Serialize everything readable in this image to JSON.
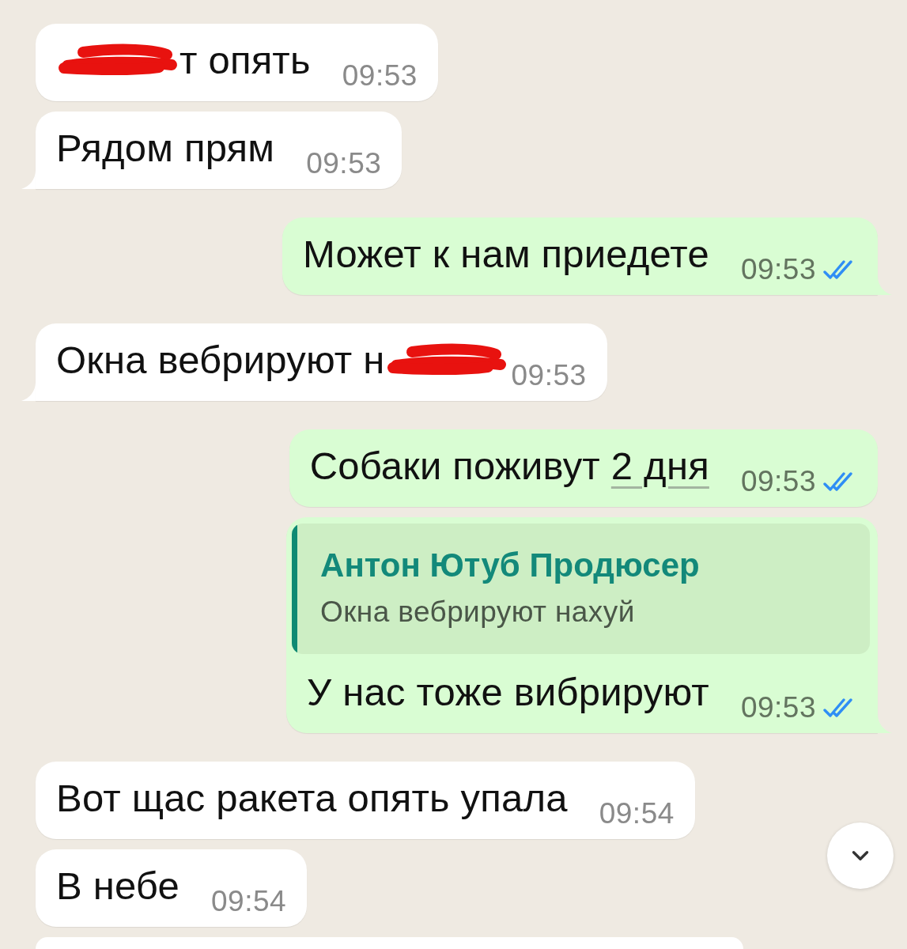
{
  "messages": [
    {
      "kind": "text",
      "outgoing": false,
      "redacted_start": true,
      "text": "т опять",
      "time": "09:53",
      "tail": false
    },
    {
      "kind": "text",
      "outgoing": false,
      "text": "Рядом прям",
      "time": "09:53",
      "tail": true
    },
    {
      "kind": "text",
      "outgoing": true,
      "text": "Может к нам приедете",
      "time": "09:53",
      "read": true,
      "tail": true
    },
    {
      "kind": "text",
      "outgoing": false,
      "text": "Окна вебрируют н",
      "redacted_end": true,
      "time": "09:53",
      "tail": true
    },
    {
      "kind": "text",
      "outgoing": true,
      "text": "Собаки поживут",
      "link": "2 дня",
      "time": "09:53",
      "read": true,
      "tail": false
    },
    {
      "kind": "reply",
      "outgoing": true,
      "quote": {
        "author": "Антон Ютуб Продюсер",
        "text": "Окна вебрируют нахуй"
      },
      "text": "У нас тоже вибрируют",
      "time": "09:53",
      "read": true,
      "tail": true
    },
    {
      "kind": "text",
      "outgoing": false,
      "text": "Вот щас ракета опять упала",
      "time": "09:54",
      "tail": false
    },
    {
      "kind": "text",
      "outgoing": false,
      "text": "В небе",
      "time": "09:54",
      "tail": false
    },
    {
      "kind": "cut_off"
    }
  ],
  "scroll_to_bottom_button": {
    "visible": true
  }
}
